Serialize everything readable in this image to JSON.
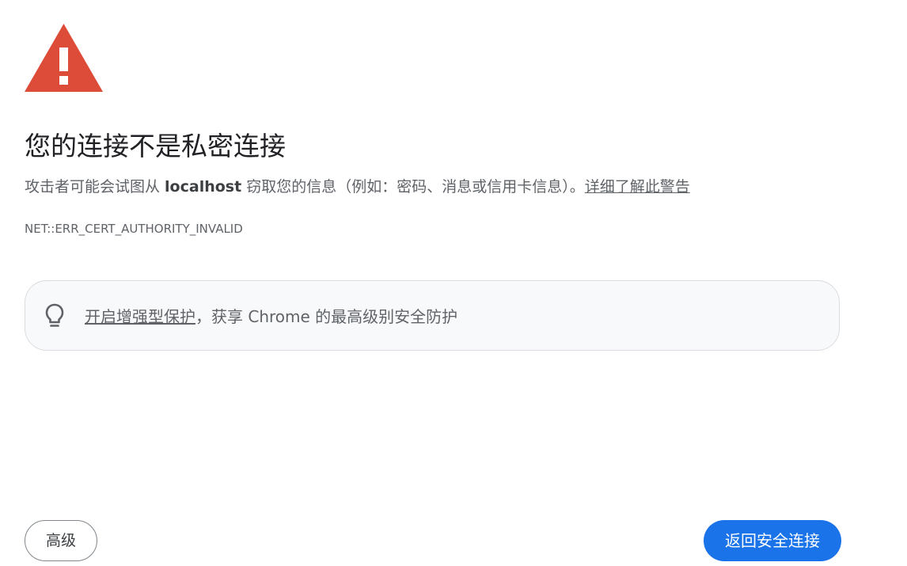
{
  "interstitial": {
    "icon": "warning-triangle-icon",
    "accent_color": "#dd4b39",
    "heading": "您的连接不是私密连接",
    "explanation": {
      "before": "攻击者可能会试图从 ",
      "host": "localhost",
      "after": " 窃取您的信息（例如：密码、消息或信用卡信息）。",
      "learn_more": "详细了解此警告"
    },
    "error_code": "NET::ERR_CERT_AUTHORITY_INVALID"
  },
  "promo": {
    "icon": "lightbulb-icon",
    "link_text": "开启增强型保护",
    "rest_text": "，获享 Chrome 的最高级别安全防护"
  },
  "buttons": {
    "advanced_label": "高级",
    "back_label": "返回安全连接",
    "primary_color": "#1a73e8"
  }
}
